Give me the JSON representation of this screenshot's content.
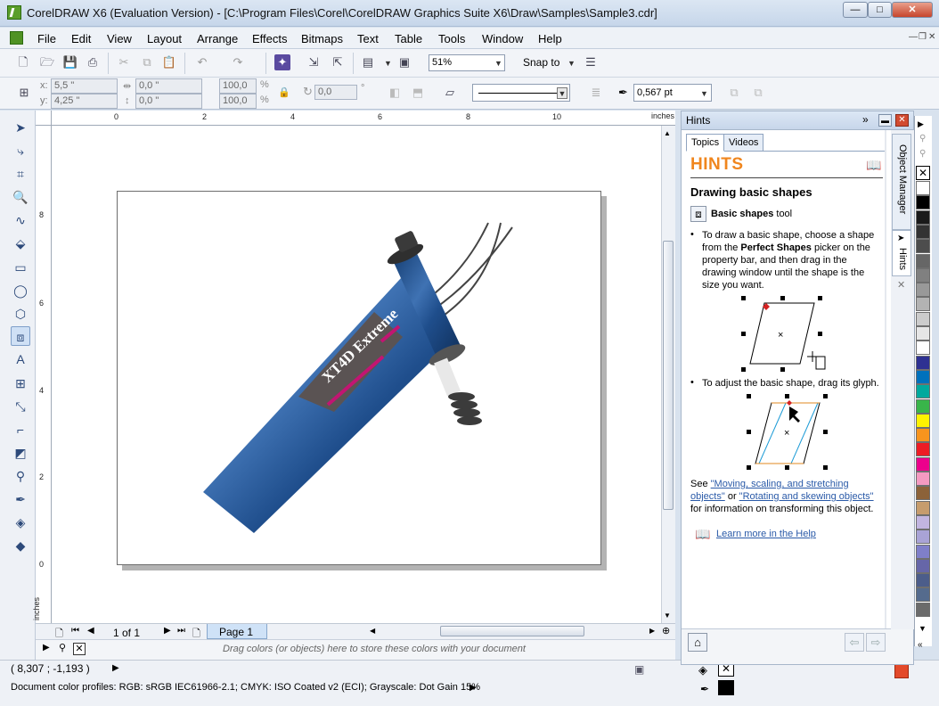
{
  "window": {
    "title": "CorelDRAW X6 (Evaluation Version) - [C:\\Program Files\\Corel\\CorelDRAW Graphics Suite X6\\Draw\\Samples\\Sample3.cdr]",
    "minimize": "—",
    "maximize": "□",
    "close": "✕"
  },
  "menu": [
    "File",
    "Edit",
    "View",
    "Layout",
    "Arrange",
    "Effects",
    "Bitmaps",
    "Text",
    "Table",
    "Tools",
    "Window",
    "Help"
  ],
  "doc_controls": {
    "minimize": "—",
    "restore": "❐",
    "close": "✕"
  },
  "toolbar": {
    "zoom": "51%",
    "snap_to": "Snap to"
  },
  "property_bar": {
    "x": "5,5 \"",
    "y": "4,25 \"",
    "width": "0,0 \"",
    "height": "0,0 \"",
    "scale_x": "100,0",
    "scale_y": "100,0",
    "pct1": "%",
    "pct2": "%",
    "angle": "0,0",
    "deg": "°",
    "outline_width": "0,567 pt",
    "x_label": "x:",
    "y_label": "y:"
  },
  "rulers": {
    "units": "inches",
    "top_ticks": [
      "0",
      "2",
      "4",
      "6",
      "8",
      "10"
    ],
    "left_ticks": [
      "8",
      "6",
      "4",
      "2",
      "0"
    ],
    "left_units": "inches"
  },
  "artwork": {
    "label": "XT4D Extreme",
    "colors": {
      "frame": "#1f4e8c",
      "frame_light": "#4f7fc0",
      "accent": "#c21572",
      "rubber": "#3b3b3b"
    }
  },
  "navigator": {
    "page_count": "1 of 1",
    "page_tab": "Page 1"
  },
  "color_tray_hint": "Drag colors (or objects) here to store these colors with your document",
  "status": {
    "coords": "( 8,307 ; -1,193 )",
    "color_profiles": "Document color profiles: RGB: sRGB IEC61966-2.1; CMYK: ISO Coated v2 (ECI); Grayscale: Dot Gain 15%"
  },
  "docker": {
    "title": "Hints",
    "tabs": [
      "Topics",
      "Videos"
    ],
    "header": "HINTS",
    "heading": "Drawing basic shapes",
    "tool_name": "Basic shapes",
    "tool_suffix": " tool",
    "bullet1_a": "To draw a basic shape, choose a shape from the ",
    "bullet1_b": "Perfect Shapes",
    "bullet1_c": " picker on the property bar, and then drag in the drawing window until the shape is the size you want.",
    "bullet2": "To adjust the basic shape, drag its glyph.",
    "see": "See ",
    "link1": "\"Moving, scaling, and stretching objects\"",
    "or": " or ",
    "link2": "\"Rotating and skewing objects\"",
    "see_tail": " for information on transforming this object.",
    "learn_more": "Learn more in the Help",
    "side_tabs": [
      "Object Manager",
      "Hints"
    ]
  },
  "palette": {
    "colors": [
      "#ffffff",
      "#000000",
      "#1a1a1a",
      "#333333",
      "#4d4d4d",
      "#666666",
      "#808080",
      "#999999",
      "#b3b3b3",
      "#cccccc",
      "#e6e6e6",
      "#ffffff",
      "#2e3192",
      "#0071bc",
      "#00a99d",
      "#39b54a",
      "#fff200",
      "#f7941d",
      "#ed1c24",
      "#ec008c",
      "#f49ac1",
      "#8c6239",
      "#c69c6d",
      "#c2b5e0",
      "#a9a3d6",
      "#7f7fc9",
      "#6666a8",
      "#4c5d8a",
      "#556b8d",
      "#6b6b6b"
    ]
  }
}
